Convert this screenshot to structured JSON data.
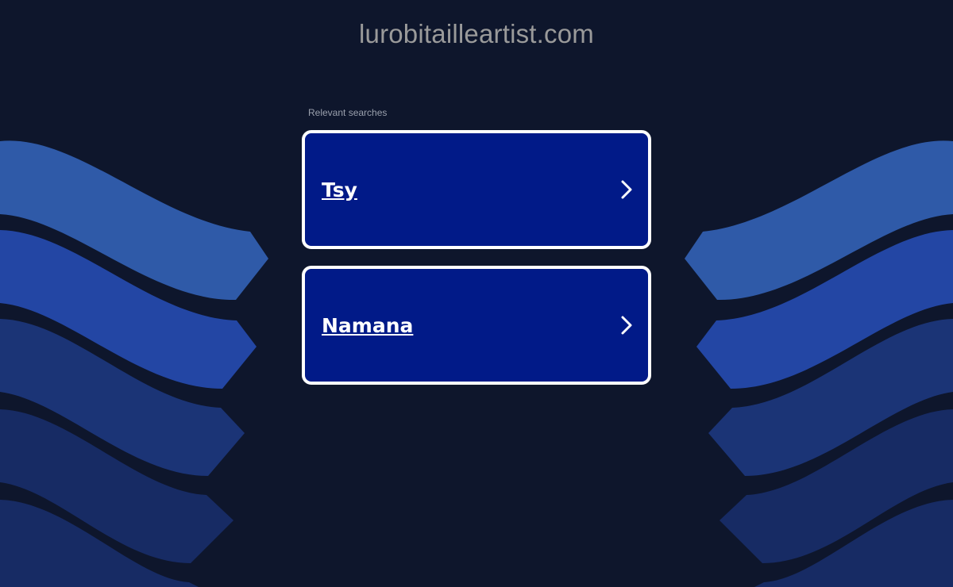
{
  "header": {
    "domain": "lurobitailleartist.com"
  },
  "searches": {
    "heading": "Relevant searches",
    "items": [
      {
        "label": "Tsy"
      },
      {
        "label": "Namana"
      }
    ]
  },
  "colors": {
    "background": "#0e162c",
    "card_fill": "#011a88",
    "card_border": "#ffffff",
    "band_light": "#2f5aa8",
    "band_mid": "#2346a4",
    "band_dark": "#1a306e",
    "title_text": "#9a9a9a"
  },
  "icons": {
    "card_arrow": "chevron-right-icon"
  }
}
